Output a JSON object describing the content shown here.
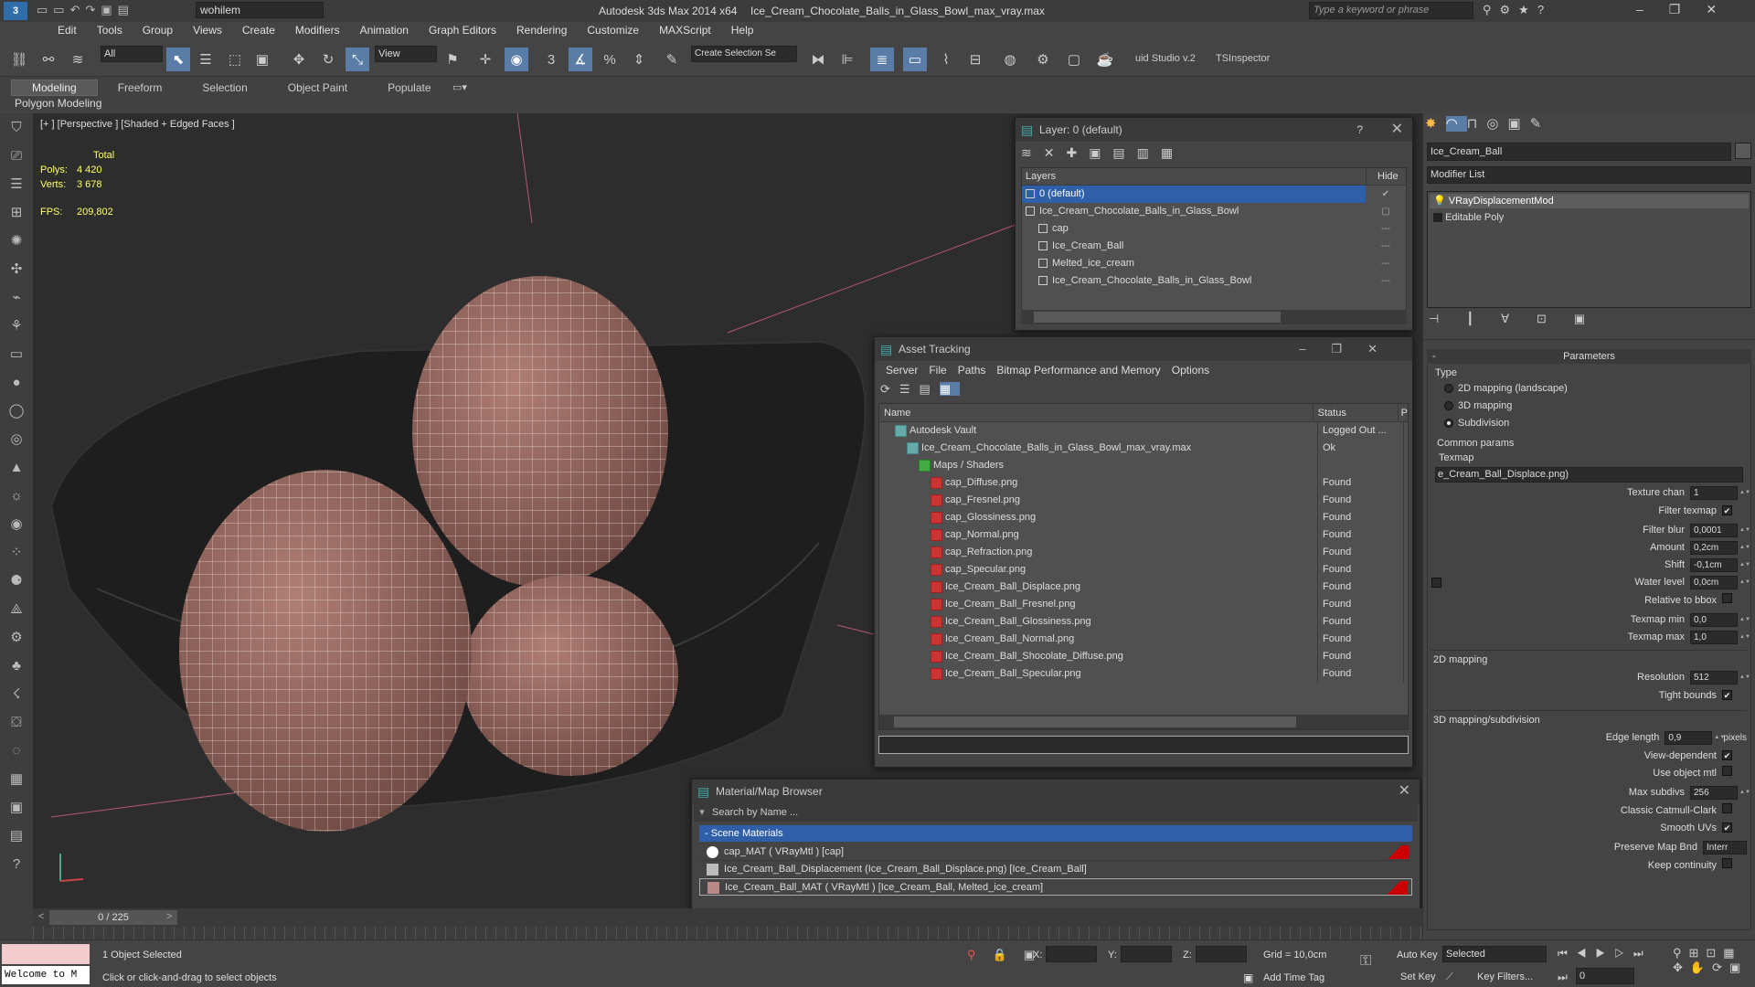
{
  "titlebar": {
    "workspace": "wohilem",
    "app": "Autodesk 3ds Max  2014 x64",
    "file": "Ice_Cream_Chocolate_Balls_in_Glass_Bowl_max_vray.max",
    "search_placeholder": "Type a keyword or phrase"
  },
  "menu": [
    "Edit",
    "Tools",
    "Group",
    "Views",
    "Create",
    "Modifiers",
    "Animation",
    "Graph Editors",
    "Rendering",
    "Customize",
    "MAXScript",
    "Help"
  ],
  "toolbar": {
    "filter": "All",
    "view": "View",
    "selection_set": "Create Selection Se",
    "studio": "uid Studio v.2",
    "inspector": "TSInspector",
    "snap_num": "3"
  },
  "ribbon": {
    "tabs": [
      "Modeling",
      "Freeform",
      "Selection",
      "Object Paint",
      "Populate"
    ],
    "active": "Modeling",
    "sub": "Polygon Modeling"
  },
  "viewport": {
    "label": "[+ ] [Perspective ] [Shaded + Edged Faces ]",
    "stats": {
      "total": "Total",
      "polys_label": "Polys:",
      "polys": "4 420",
      "verts_label": "Verts:",
      "verts": "3 678",
      "fps_label": "FPS:",
      "fps": "209,802"
    }
  },
  "layer_win": {
    "title": "Layer: 0 (default)",
    "help": "?",
    "col_layers": "Layers",
    "col_hide": "Hide",
    "rows": [
      {
        "name": "0 (default)",
        "indent": 0,
        "selected": true
      },
      {
        "name": "Ice_Cream_Chocolate_Balls_in_Glass_Bowl",
        "indent": 0
      },
      {
        "name": "cap",
        "indent": 1
      },
      {
        "name": "Ice_Cream_Ball",
        "indent": 1
      },
      {
        "name": "Melted_ice_cream",
        "indent": 1
      },
      {
        "name": "Ice_Cream_Chocolate_Balls_in_Glass_Bowl",
        "indent": 1
      }
    ]
  },
  "asset_win": {
    "title": "Asset Tracking",
    "menu": [
      "Server",
      "File",
      "Paths",
      "Bitmap Performance and Memory",
      "Options"
    ],
    "col_name": "Name",
    "col_status": "Status",
    "col_p": "P",
    "rows": [
      {
        "name": "Autodesk Vault",
        "status": "Logged Out ...",
        "indent": 1
      },
      {
        "name": "Ice_Cream_Chocolate_Balls_in_Glass_Bowl_max_vray.max",
        "status": "Ok",
        "indent": 2
      },
      {
        "name": "Maps / Shaders",
        "status": "",
        "indent": 3
      },
      {
        "name": "cap_Diffuse.png",
        "status": "Found",
        "indent": 4
      },
      {
        "name": "cap_Fresnel.png",
        "status": "Found",
        "indent": 4
      },
      {
        "name": "cap_Glossiness.png",
        "status": "Found",
        "indent": 4
      },
      {
        "name": "cap_Normal.png",
        "status": "Found",
        "indent": 4
      },
      {
        "name": "cap_Refraction.png",
        "status": "Found",
        "indent": 4
      },
      {
        "name": "cap_Specular.png",
        "status": "Found",
        "indent": 4
      },
      {
        "name": "Ice_Cream_Ball_Displace.png",
        "status": "Found",
        "indent": 4
      },
      {
        "name": "Ice_Cream_Ball_Fresnel.png",
        "status": "Found",
        "indent": 4
      },
      {
        "name": "Ice_Cream_Ball_Glossiness.png",
        "status": "Found",
        "indent": 4
      },
      {
        "name": "Ice_Cream_Ball_Normal.png",
        "status": "Found",
        "indent": 4
      },
      {
        "name": "Ice_Cream_Ball_Shocolate_Diffuse.png",
        "status": "Found",
        "indent": 4
      },
      {
        "name": "Ice_Cream_Ball_Specular.png",
        "status": "Found",
        "indent": 4
      }
    ]
  },
  "mat_win": {
    "title": "Material/Map Browser",
    "search": "Search by Name ...",
    "group": "- Scene Materials",
    "rows": [
      "cap_MAT  ( VRayMtl )  [cap]",
      "Ice_Cream_Ball_Displacement (Ice_Cream_Ball_Displace.png) [Ice_Cream_Ball]",
      "Ice_Cream_Ball_MAT  ( VRayMtl )  [Ice_Cream_Ball, Melted_ice_cream]"
    ]
  },
  "cmd": {
    "object_name": "Ice_Cream_Ball",
    "modifier_list": "Modifier List",
    "stack": [
      "VRayDisplacementMod",
      "Editable Poly"
    ],
    "params_title": "Parameters",
    "type_label": "Type",
    "types": [
      "2D mapping (landscape)",
      "3D mapping",
      "Subdivision"
    ],
    "type_selected": 2,
    "common": "Common params",
    "texmap_label": "Texmap",
    "texmap": "e_Cream_Ball_Displace.png)",
    "texture_chan": {
      "label": "Texture chan",
      "value": "1"
    },
    "filter_texmap": "Filter texmap",
    "filter_blur": {
      "label": "Filter blur",
      "value": "0,0001"
    },
    "amount": {
      "label": "Amount",
      "value": "0,2cm"
    },
    "shift": {
      "label": "Shift",
      "value": "-0,1cm"
    },
    "water_level": {
      "label": "Water level",
      "value": "0,0cm"
    },
    "relative": "Relative to bbox",
    "texmap_min": {
      "label": "Texmap min",
      "value": "0,0"
    },
    "texmap_max": {
      "label": "Texmap max",
      "value": "1,0"
    },
    "map2d": "2D mapping",
    "resolution": {
      "label": "Resolution",
      "value": "512"
    },
    "tight": "Tight bounds",
    "map3d": "3D mapping/subdivision",
    "edge_length": {
      "label": "Edge length",
      "value": "0,9",
      "unit": "pixels"
    },
    "view_dep": "View-dependent",
    "use_obj": "Use object mtl",
    "max_subdivs": {
      "label": "Max subdivs",
      "value": "256"
    },
    "catmull": "Classic Catmull-Clark",
    "smooth_uv": "Smooth UVs",
    "preserve": {
      "label": "Preserve Map Bnd",
      "value": "Interr"
    },
    "keep": "Keep continuity"
  },
  "timeline": {
    "frame": "0 / 225"
  },
  "status": {
    "welcome": "Welcome to M",
    "selected": "1 Object Selected",
    "hint": "Click or click-and-drag to select objects",
    "x": "X:",
    "y": "Y:",
    "z": "Z:",
    "grid": "Grid = 10,0cm",
    "add_tag": "Add Time Tag",
    "auto_key": "Auto Key",
    "set_key": "Set Key",
    "key_mode": "Selected",
    "key_filters": "Key Filters...",
    "frame": "0"
  }
}
